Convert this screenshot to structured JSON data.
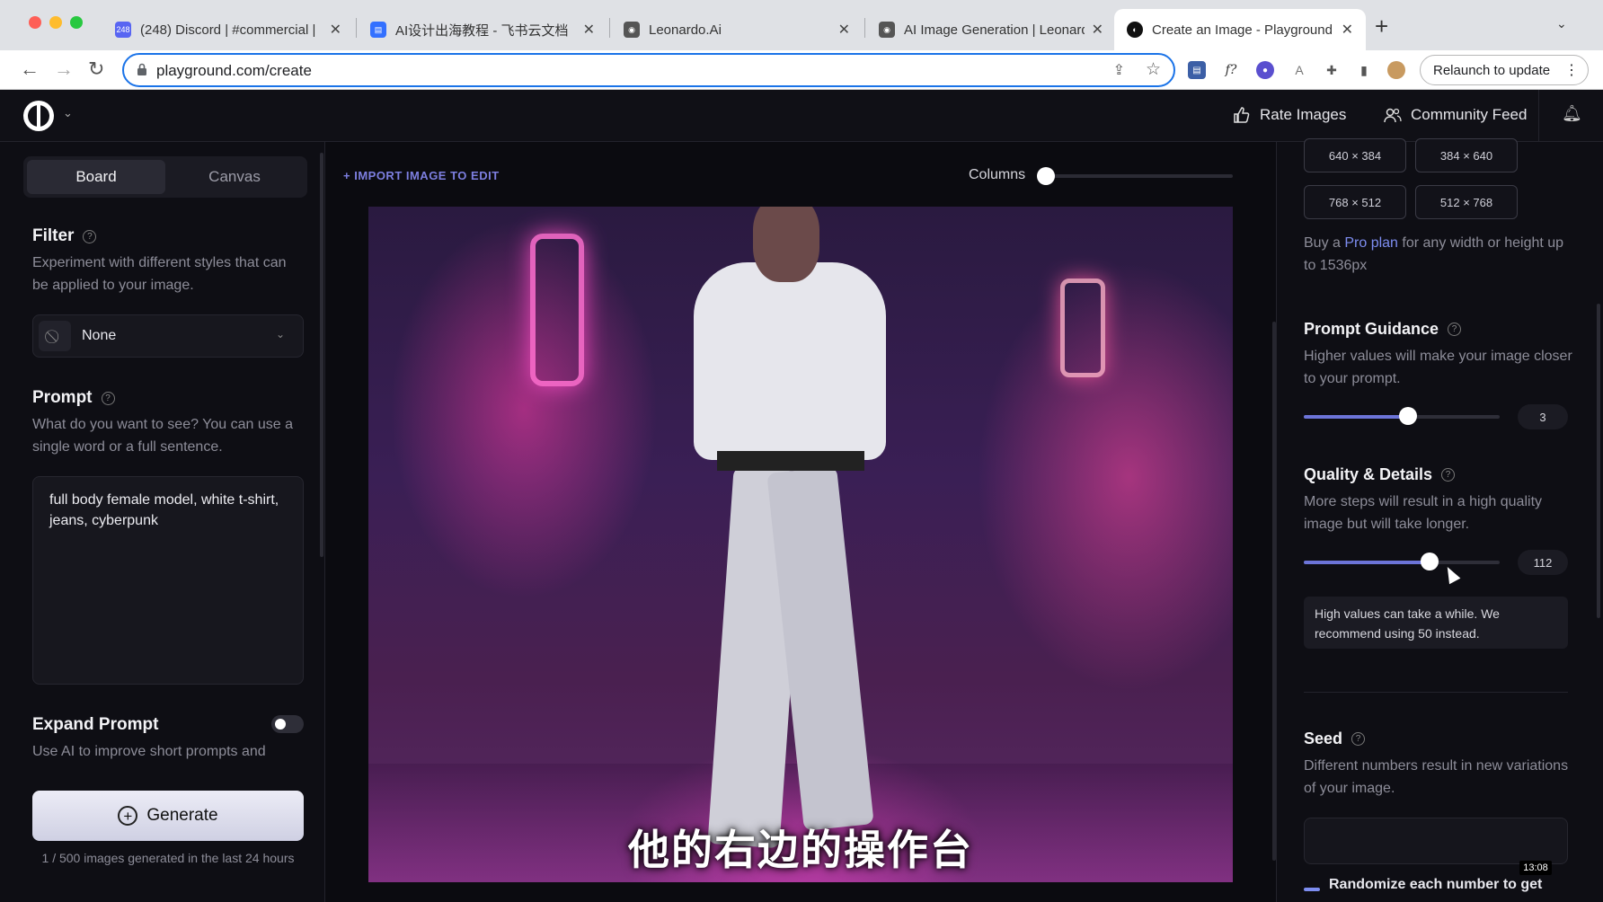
{
  "browser": {
    "tabs": [
      {
        "title": "(248) Discord | #commercial |",
        "favicon": "discord-icon",
        "badge": "248"
      },
      {
        "title": "AI设计出海教程 - 飞书云文档",
        "favicon": "doc-icon"
      },
      {
        "title": "Leonardo.Ai",
        "favicon": "leonardo-icon"
      },
      {
        "title": "AI Image Generation | Leonardo",
        "favicon": "leonardo-icon"
      },
      {
        "title": "Create an Image - Playground",
        "favicon": "playground-icon",
        "active": true
      }
    ],
    "url": "playground.com/create",
    "relaunch_label": "Relaunch to update"
  },
  "header": {
    "rate_images": "Rate Images",
    "community_feed": "Community Feed"
  },
  "left": {
    "tabs": {
      "board": "Board",
      "canvas": "Canvas"
    },
    "filter": {
      "title": "Filter",
      "description": "Experiment with different styles that can be applied to your image.",
      "selected": "None"
    },
    "prompt": {
      "title": "Prompt",
      "description": "What do you want to see? You can use a single word or a full sentence.",
      "value": "full body female model, white t-shirt, jeans, cyberpunk"
    },
    "expand_prompt": {
      "title": "Expand Prompt",
      "description": "Use AI to improve short prompts and"
    },
    "generate_label": "Generate",
    "generate_note": "1 / 500 images generated in the last 24 hours"
  },
  "center": {
    "import_label": "+ IMPORT IMAGE TO EDIT",
    "columns_label": "Columns",
    "subtitle": "他的右边的操作台"
  },
  "right": {
    "dimensions": [
      "640 × 384",
      "384 × 640",
      "768 × 512",
      "512 × 768"
    ],
    "pro_text_before": "Buy a ",
    "pro_link": "Pro plan",
    "pro_text_after": " for any width or height up to 1536px",
    "prompt_guidance": {
      "title": "Prompt Guidance",
      "description": "Higher values will make your image closer to your prompt.",
      "value": "3",
      "fraction": 0.53
    },
    "quality": {
      "title": "Quality & Details",
      "description": "More steps will result in a high quality image but will take longer.",
      "value": "112",
      "fraction": 0.64,
      "warning": "High values can take a while. We recommend using 50 instead."
    },
    "seed": {
      "title": "Seed",
      "description": "Different numbers result in new variations of your image."
    },
    "randomize_label": "Randomize each number to get",
    "timestamp": "13:08"
  },
  "colors": {
    "accent": "#7d8df0",
    "slider_fill": "#6c74d8",
    "background": "#0b0b10"
  }
}
